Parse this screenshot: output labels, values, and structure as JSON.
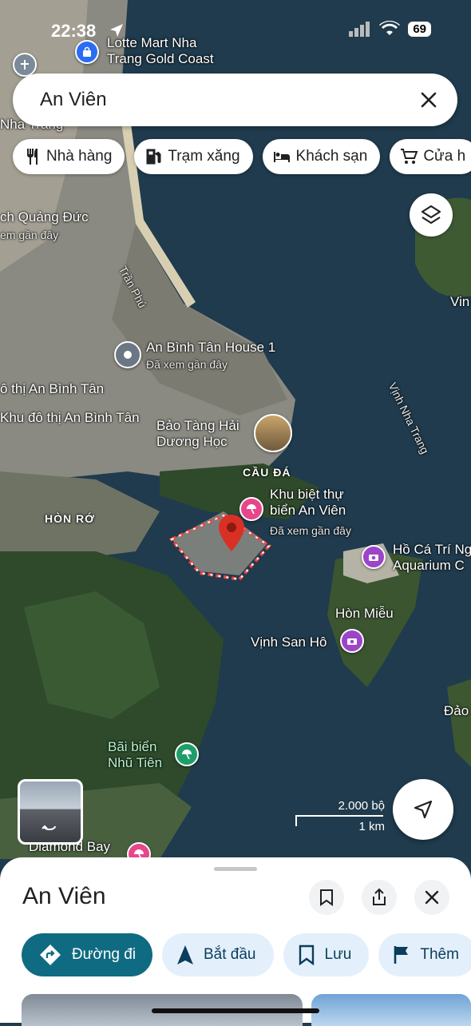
{
  "status": {
    "time": "22:38",
    "battery": "69"
  },
  "search": {
    "value": "An Viên"
  },
  "chips": [
    {
      "label": "Nhà hàng",
      "icon": "restaurant-icon"
    },
    {
      "label": "Trạm xăng",
      "icon": "gas-station-icon"
    },
    {
      "label": "Khách sạn",
      "icon": "hotel-icon"
    },
    {
      "label": "Cửa h",
      "icon": "shopping-cart-icon"
    }
  ],
  "map_labels": {
    "lotte": "Lotte Mart Nha\nTrang Gold Coast",
    "nha_trang_partial": "Nha Trang",
    "quang_duc": "ch Quảng Đức",
    "quang_duc_sub": "em gần đây",
    "tran_phu": "Trần Phú",
    "an_binh_tan_house": "An Bình Tân House 1",
    "an_binh_tan_house_sub": "Đã xem gần đây",
    "do_thi_abt": "ô thị An Bình Tân",
    "khu_do_thi": "Khu đô thị An Bình Tân",
    "bao_tang": "Bảo Tàng Hải\nDương Học",
    "cau_da": "CẦU ĐÁ",
    "hon_ro": "HÒN RỚ",
    "khu_biet_thu": "Khu biệt thự\nbiển An Viên",
    "khu_biet_thu_sub": "Đã xem gần đây",
    "vinh_nha_trang": "Vịnh Nha Trang",
    "ho_ca": "Hồ Cá Trí Ng\nAquarium C",
    "hon_mieu": "Hòn Miễu",
    "vinh_san_ho": "Vịnh San Hô",
    "vin_partial": "Vin",
    "dao_partial": "Đảo",
    "bai_bien": "Bãi biển\nNhũ Tiên",
    "diamond_bay": "Diamond Bay"
  },
  "scale": {
    "top": "2.000 bộ",
    "bottom": "1 km"
  },
  "place": {
    "title": "An Viên",
    "actions": [
      {
        "label": "Đường đi",
        "icon": "directions-icon"
      },
      {
        "label": "Bắt đầu",
        "icon": "navigation-arrow-icon"
      },
      {
        "label": "Lưu",
        "icon": "bookmark-icon"
      },
      {
        "label": "Thêm",
        "icon": "flag-icon"
      }
    ]
  },
  "colors": {
    "primary": "#0f6b82",
    "pin_red": "#d93025",
    "poi_pink": "#e8458b",
    "poi_purple": "#9c45c9",
    "poi_green": "#1e9e6a"
  }
}
